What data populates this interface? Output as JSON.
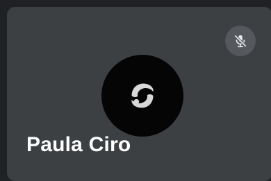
{
  "participant": {
    "name": "Paula Ciro",
    "muted": true,
    "mute_icon": "microphone-off-icon",
    "avatar_icon": "swirl-logo-icon"
  },
  "colors": {
    "background": "#202124",
    "tile": "#3c4043",
    "badge": "#55585c",
    "avatar": "#050505",
    "text": "#ffffff"
  }
}
